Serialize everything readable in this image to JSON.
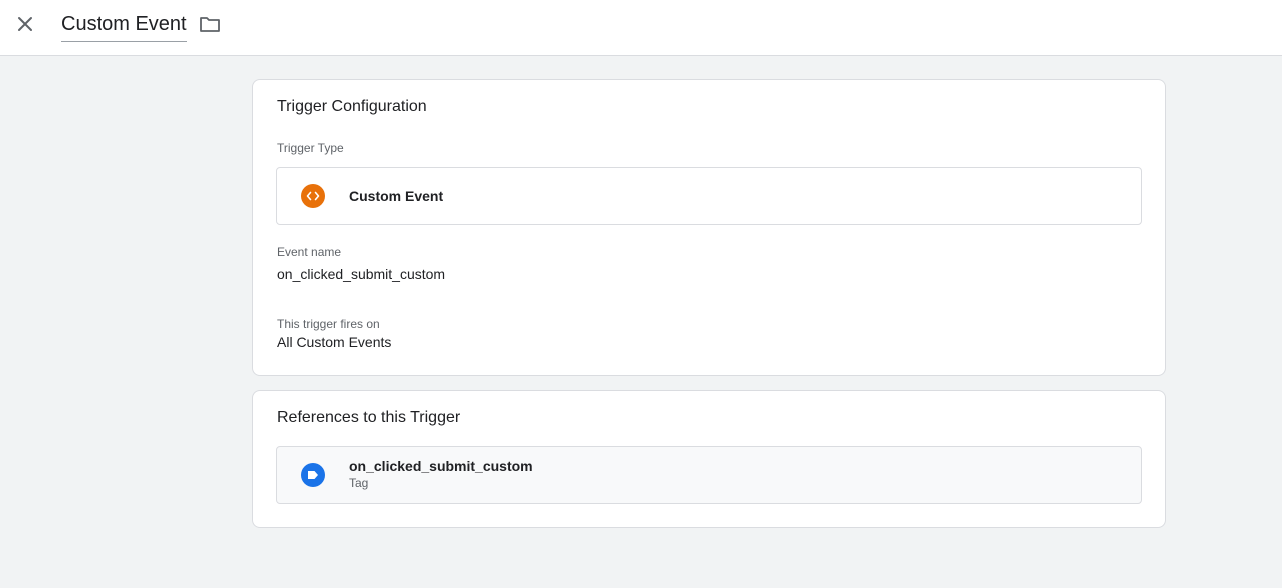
{
  "header": {
    "title": "Custom Event",
    "close_icon": "close-icon",
    "folder_icon": "folder-icon"
  },
  "trigger_configuration": {
    "title": "Trigger Configuration",
    "trigger_type_label": "Trigger Type",
    "trigger_type_value": "Custom Event",
    "trigger_type_icon": "code-brackets-icon",
    "trigger_type_icon_color": "#e8710a",
    "event_name_label": "Event name",
    "event_name_value": "on_clicked_submit_custom",
    "fires_on_label": "This trigger fires on",
    "fires_on_value": "All Custom Events"
  },
  "references": {
    "title": "References to this Trigger",
    "items": [
      {
        "name": "on_clicked_submit_custom",
        "type": "Tag",
        "icon": "tag-icon",
        "icon_color": "#1a73e8"
      }
    ]
  }
}
